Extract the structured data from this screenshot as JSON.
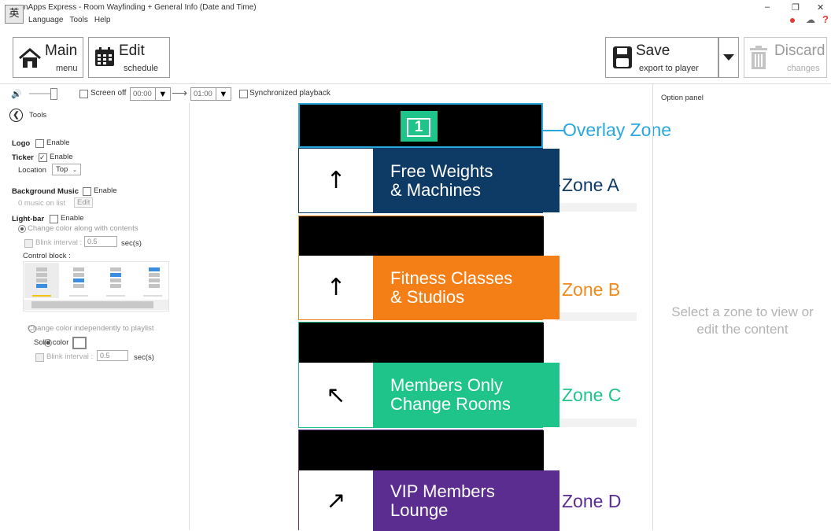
{
  "window": {
    "title": "nApps Express - Room Wayfinding + General Info (Date and Time)",
    "ime_glyph": "英",
    "controls": [
      "–",
      "❐",
      "✕"
    ]
  },
  "menu": [
    "Language",
    "Tools",
    "Help"
  ],
  "toolbar": {
    "main": {
      "big": "Main",
      "small": "menu"
    },
    "edit": {
      "big": "Edit",
      "small": "schedule"
    },
    "save": {
      "big": "Save",
      "small": "export to player"
    },
    "discard": {
      "big": "Discard",
      "small": "changes"
    }
  },
  "controls": {
    "screen_off_label": "Screen off",
    "start_time": "00:00",
    "end_time": "01:00",
    "sync_label": "Synchronized playback"
  },
  "tools": {
    "header": "Tools",
    "logo_label": "Logo",
    "enable": "Enable",
    "ticker_label": "Ticker",
    "location_label": "Location",
    "location_value": "Top",
    "bg_music_label": "Background Music",
    "music_count": "0 music on list",
    "edit_label": "Edit",
    "lightbar_label": "Light-bar",
    "change_along": "Change color along with contents",
    "blink_label": "Blink interval :",
    "blink_value": "0.5",
    "sec_label": "sec(s)",
    "control_block": "Control block :",
    "change_independent": "Change color independently to playlist",
    "solid_color": "Solid color"
  },
  "option_panel": {
    "title": "Option panel",
    "hint_line1": "Select a zone to view or",
    "hint_line2": "edit the content"
  },
  "overlay": {
    "number": "1",
    "caption": "Overlay Zone",
    "color": "#29a8e0"
  },
  "zones": [
    {
      "caption": "Zone A",
      "arrow": "↑",
      "line1": "Free Weights",
      "line2": "& Machines",
      "color": "#0e3a66",
      "caption_color": "#0e3a66"
    },
    {
      "caption": "Zone B",
      "arrow": "↑",
      "line1": "Fitness Classes",
      "line2": "& Studios",
      "color": "#f57f17",
      "caption_color": "#f08a1c"
    },
    {
      "caption": "Zone C",
      "arrow": "↖",
      "line1": "Members Only",
      "line2": "Change Rooms",
      "color": "#1ec48a",
      "caption_color": "#1ec48a"
    },
    {
      "caption": "Zone D",
      "arrow": "↗",
      "line1": "VIP Members",
      "line2": "Lounge",
      "color": "#5c2d91",
      "caption_color": "#5c2d91"
    }
  ]
}
